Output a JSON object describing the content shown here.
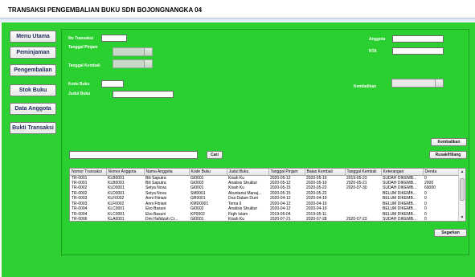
{
  "window": {
    "title": "TRANSAKSI PENGEMBALIAN BUKU SDN BOJONGNANGKA 04"
  },
  "menu": [
    {
      "label": "Menu Utama"
    },
    {
      "label": "Peminjaman"
    },
    {
      "label": "Pengembalian"
    },
    {
      "label": "Stok Buku"
    },
    {
      "label": "Data Anggota"
    },
    {
      "label": "Bukti Transaksi"
    }
  ],
  "form": {
    "no_transaksi_label": "No Transaksi",
    "tanggal_pinjam_label": "Tanggal Pinjam",
    "tanggal_kembali_label": "Tanggal Kembali",
    "kode_buku_label": "Kode Buku",
    "judul_buku_label": "Judul Buku",
    "anggota_label": "Anggota",
    "nta_label": "NTA",
    "kembalikan_label": "Kembalikan"
  },
  "buttons": {
    "kembalikan": "Kembalikan",
    "cari": "Cari",
    "rusak_hilang": "Rusak/Hilang",
    "segarkan": "Segarkan"
  },
  "table": {
    "columns": [
      "Nomor Transaksi",
      "Nomor Anggota",
      "Nama Anggota",
      "Kode Buku",
      "Judul Buku",
      "Tanggal Pinjam",
      "Batas Kembali",
      "Tanggal Kembali",
      "Keterangan",
      "Denda"
    ],
    "rows": [
      [
        "TR-0001",
        "KLB0001",
        "Bili Saputra",
        "GI0001",
        "Kisah Ku",
        "2020-05-12",
        "2020-05-19",
        "2019-05-23",
        "SUDAH DIKEMB...",
        "0"
      ],
      [
        "TR-0001",
        "KLB0001",
        "Bili Saputra",
        "GI0002",
        "Analisis Struktur",
        "2020-05-12",
        "2020-05-19",
        "2020-05-21",
        "SUDAH DIKEMB...",
        "2000"
      ],
      [
        "TR-0002",
        "KLD0001",
        "Setya Nova",
        "GI0001",
        "Kisah Ku",
        "2020-05-15",
        "2020-05-22",
        "2020-07-30",
        "SUDAH DIKEMB...",
        "69000"
      ],
      [
        "TR-0002",
        "KLD0001",
        "Setya Nova",
        "SM0001",
        "Akuntansi Manaj...",
        "2020-05-15",
        "2020-05-22",
        "",
        "BELUM DIKEMB...",
        "0"
      ],
      [
        "TR-0003",
        "KLF0002",
        "Anni Fitriani",
        "GR0001",
        "Doa Dalam Durri",
        "2020-04-12",
        "2020-04-19",
        "",
        "BELUM DIKEMB...",
        "0"
      ],
      [
        "TR-0003",
        "KLF0002",
        "Anni Fitriani",
        "KMD0001",
        "Tema 6",
        "2020-04-12",
        "2020-04-19",
        "",
        "BELUM DIKEMB...",
        "0"
      ],
      [
        "TR-0004",
        "KLC0001",
        "Eko Basuni",
        "GI0002",
        "Analisis Struktur",
        "2020-04-12",
        "2020-04-19",
        "",
        "BELUM DIKEMB...",
        "0"
      ],
      [
        "TR-0004",
        "KLC0001",
        "Eko Basuni",
        "KP0002",
        "Fiqih Islam",
        "2019-05-04",
        "2019-05-11",
        "",
        "BELUM DIKEMB...",
        "0"
      ],
      [
        "TR-0006",
        "KLA0001",
        "Dini Hafidzah Cr...",
        "GI0001",
        "Kisah Ku",
        "2020-07-21",
        "2020-07-28",
        "2020-07-23",
        "SUDAH DIKEMB...",
        "0"
      ]
    ]
  },
  "colors": {
    "background": "#2ed131",
    "panel_border": "#1d9e22",
    "label_text": "#ffffff"
  }
}
